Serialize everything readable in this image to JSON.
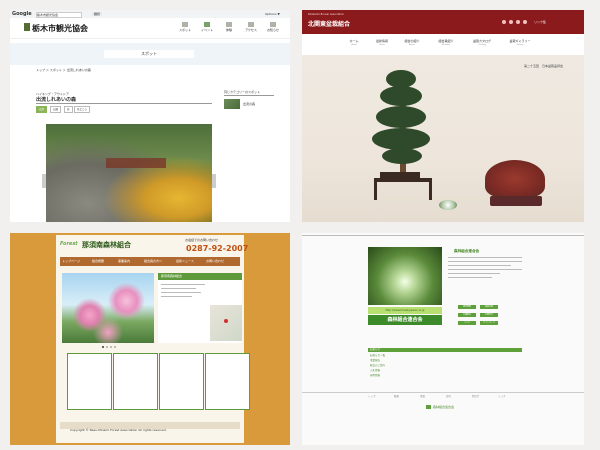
{
  "panel1": {
    "google_bar": {
      "logo": "Google",
      "search_value": "栃木市観光協会",
      "translate_label": "翻訳",
      "options": "Options ▼"
    },
    "site_title": "栃木市観光協会",
    "nav": [
      {
        "label": "スポット"
      },
      {
        "label": "イベント"
      },
      {
        "label": "体験"
      },
      {
        "label": "アクセス"
      },
      {
        "label": "お知らせ"
      }
    ],
    "section_title": "スポット",
    "breadcrumb": "トップ ＞ スポット ＞ 出流しれあいの森",
    "category": "ハイキング・アウトドア",
    "page_title": "出流しれあいの森",
    "tags": [
      "自然",
      "公園",
      "花",
      "見どころ"
    ],
    "sidebar_title": "同じカテゴリーのスポット",
    "sidebar_item": "出流の森"
  },
  "panel2": {
    "title_en": "Kitakanto Bonsai Association",
    "title_jp": "北関東盆栽組合",
    "link_label": "リンク集",
    "nav": [
      {
        "jp": "ホーム",
        "en": "Home"
      },
      {
        "jp": "最新情報",
        "en": "News"
      },
      {
        "jp": "組合の紹介",
        "en": "About"
      },
      {
        "jp": "組合員紹介",
        "en": "Member"
      },
      {
        "jp": "盆栽カタログ",
        "en": "Catalog"
      },
      {
        "jp": "盆栽ギャラリー",
        "en": "Gallery"
      }
    ],
    "hero_caption": "第二十五回　日本盆栽品評会"
  },
  "panel3": {
    "logo_en": "Forest",
    "logo_jp": "那須南森林組合",
    "tel_label": "お電話でのお問い合わせ",
    "tel": "0287-92-2007",
    "nav": [
      "トップページ",
      "組合概要",
      "事業案内",
      "組合員の方へ",
      "最新ニュース",
      "お問い合わせ"
    ],
    "info_title": "那須南森林組合",
    "boxes": [
      "お知らせ",
      "森林組合について",
      "森林組合ニュース",
      "組合員の方へ"
    ],
    "copyright": "Copyright © Nasu-Minami Forest Association All rights reserved."
  },
  "panel4": {
    "banner": "http://www.forestryassoc.or.jp",
    "big_title": "森林組合連合会",
    "right_heading": "森林組合連合会",
    "buttons": [
      "組合概要",
      "事業内容",
      "交通案内",
      "お問合せ",
      "リンク",
      "サイトマップ"
    ],
    "section_bar": "お知らせ",
    "list": [
      "お知らせ一覧",
      "事業報告",
      "総会のご案内",
      "入札情報",
      "採用情報"
    ],
    "bottom_links": [
      "トップ",
      "概要",
      "事業",
      "案内",
      "問合せ",
      "リンク"
    ],
    "footer_name": "森林組合連合会"
  }
}
